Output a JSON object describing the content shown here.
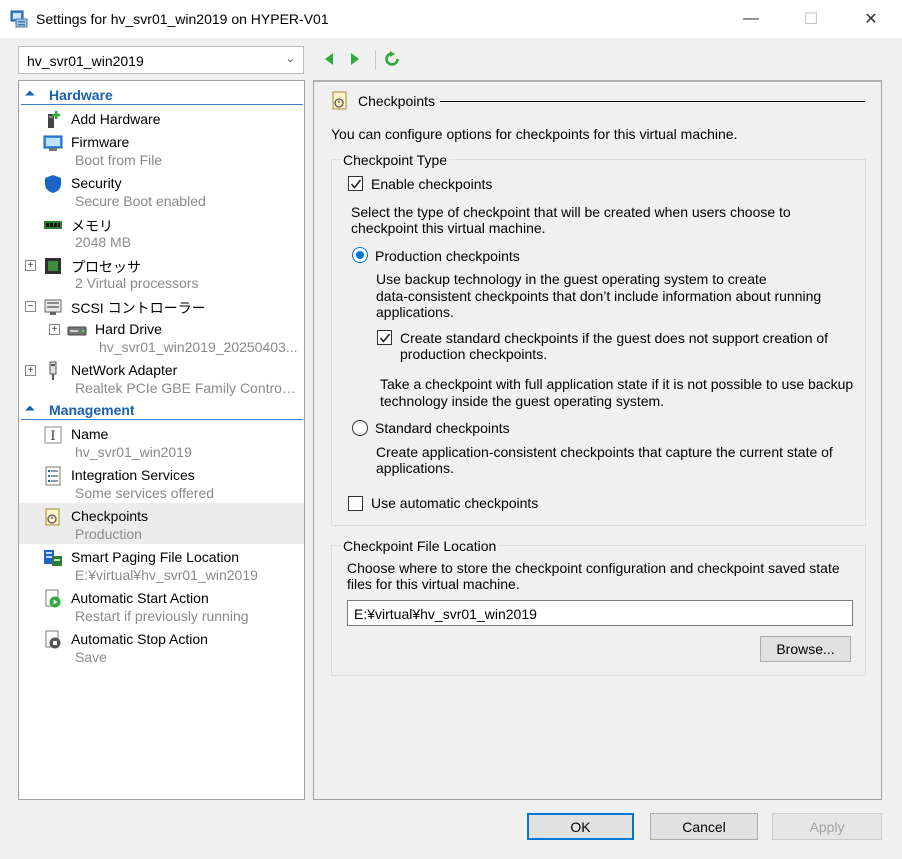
{
  "window": {
    "title": "Settings for hv_svr01_win2019 on HYPER-V01",
    "minimize_glyph": "—",
    "maximize_glyph": "☐",
    "close_glyph": "✕"
  },
  "vm_selector": {
    "value": "hv_svr01_win2019"
  },
  "tree": {
    "hardware_header": "Hardware",
    "management_header": "Management",
    "items": [
      {
        "name": "Add Hardware",
        "sub": ""
      },
      {
        "name": "Firmware",
        "sub": "Boot from File"
      },
      {
        "name": "Security",
        "sub": "Secure Boot enabled"
      },
      {
        "name": "メモリ",
        "sub": "2048 MB"
      },
      {
        "name": "プロセッサ",
        "sub": "2 Virtual processors"
      },
      {
        "name": "SCSI コントローラー",
        "sub": ""
      },
      {
        "name": "Hard Drive",
        "sub": "hv_svr01_win2019_20250403..."
      },
      {
        "name": "NetWork Adapter",
        "sub": "Realtek PCIe GBE Family Controller..."
      },
      {
        "name": "Name",
        "sub": "hv_svr01_win2019"
      },
      {
        "name": "Integration Services",
        "sub": "Some services offered"
      },
      {
        "name": "Checkpoints",
        "sub": "Production"
      },
      {
        "name": "Smart Paging File Location",
        "sub": "E:¥virtual¥hv_svr01_win2019"
      },
      {
        "name": "Automatic Start Action",
        "sub": "Restart if previously running"
      },
      {
        "name": "Automatic Stop Action",
        "sub": "Save"
      }
    ]
  },
  "panel": {
    "heading": "Checkpoints",
    "intro": "You can configure options for checkpoints for this virtual machine.",
    "checkpoint_type_label": "Checkpoint Type",
    "enable_checkpoints": "Enable checkpoints",
    "select_type_text_1": "Select the type of checkpoint that will be created when users choose to",
    "select_type_text_2": "checkpoint this virtual machine.",
    "production_label": "Production checkpoints",
    "production_desc_1": "Use backup technology in the guest operating system to create",
    "production_desc_2": "data-consistent checkpoints that don’t include information about running",
    "production_desc_3": "applications.",
    "create_standard_1": "Create standard checkpoints if the guest does not support creation of",
    "create_standard_2": "production checkpoints.",
    "take_checkpoint_1": "Take a checkpoint with full application state if it is not possible to use backup",
    "take_checkpoint_2": "technology inside the guest operating system.",
    "standard_label": "Standard checkpoints",
    "standard_desc_1": "Create application-consistent checkpoints that capture the current state of",
    "standard_desc_2": "applications.",
    "automatic_label": "Use automatic checkpoints",
    "file_location_label": "Checkpoint File Location",
    "file_location_desc_1": "Choose where to store the checkpoint configuration and checkpoint saved state",
    "file_location_desc_2": "files for this virtual machine.",
    "file_location_value": "E:¥virtual¥hv_svr01_win2019",
    "browse_label": "Browse..."
  },
  "footer": {
    "ok_label": "OK",
    "cancel_label": "Cancel",
    "apply_label": "Apply"
  },
  "colors": {
    "accent": "#0078d7",
    "section_header": "#1a5fb0",
    "nav_arrow": "#2eab3a"
  }
}
